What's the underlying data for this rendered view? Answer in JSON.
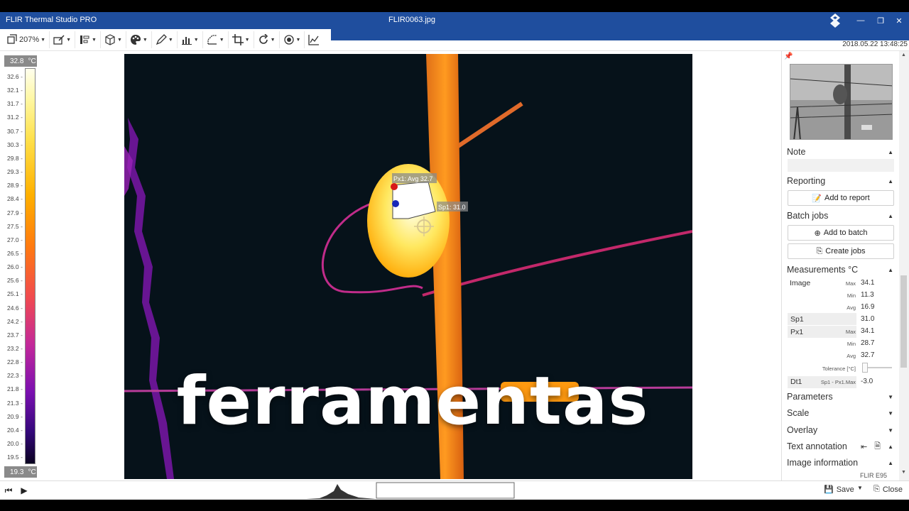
{
  "window": {
    "app_title": "FLIR Thermal Studio PRO",
    "file_title": "FLIR0063.jpg",
    "datetime": "2018.05.22 13:48:25"
  },
  "toolbar": {
    "zoom_label": "207%",
    "tools": [
      "rotate-icon",
      "annotate-icon",
      "align-icon",
      "cube-icon",
      "palette-icon",
      "pen-icon",
      "chart-bar-icon",
      "measure-icon",
      "crop-icon",
      "refresh-icon",
      "target-icon",
      "graph-icon"
    ]
  },
  "temperature_scale": {
    "max": "32.8",
    "min": "19.3",
    "unit": "°C",
    "ticks": [
      "32.6",
      "32.1",
      "31.7",
      "31.2",
      "30.7",
      "30.3",
      "29.8",
      "29.3",
      "28.9",
      "28.4",
      "27.9",
      "27.5",
      "27.0",
      "26.5",
      "26.0",
      "25.6",
      "25.1",
      "24.6",
      "24.2",
      "23.7",
      "23.2",
      "22.8",
      "22.3",
      "21.8",
      "21.3",
      "20.9",
      "20.4",
      "20.0",
      "19.5"
    ]
  },
  "image_overlays": {
    "px1_label": "Px1:  Avg 32.7",
    "sp1_label": "Sp1: 31.0",
    "caption": "ferramentas"
  },
  "panel": {
    "note_label": "Note",
    "reporting_label": "Reporting",
    "add_to_report": "Add to report",
    "batch_label": "Batch jobs",
    "add_to_batch": "Add to batch",
    "create_jobs": "Create jobs",
    "measurements_label": "Measurements °C",
    "image_label": "Image",
    "image_max_key": "Max",
    "image_max": "34.1",
    "image_min_key": "Min",
    "image_min": "11.3",
    "image_avg_key": "Avg",
    "image_avg": "16.9",
    "sp1_label": "Sp1",
    "sp1_value": "31.0",
    "px1_label": "Px1",
    "px1_max_key": "Max",
    "px1_max": "34.1",
    "px1_min_key": "Min",
    "px1_min": "28.7",
    "px1_avg_key": "Avg",
    "px1_avg": "32.7",
    "tolerance_label": "Tolerance  [°C]",
    "dt1_label": "Dt1",
    "dt1_formula": "Sp1 - Px1.Max",
    "dt1_value": "-3.0",
    "parameters_label": "Parameters",
    "scale_label": "Scale",
    "overlay_label": "Overlay",
    "text_annotation_label": "Text annotation",
    "image_information_label": "Image information",
    "camera_label": "FLIR E95"
  },
  "bottom": {
    "save_label": "Save",
    "close_label": "Close"
  }
}
